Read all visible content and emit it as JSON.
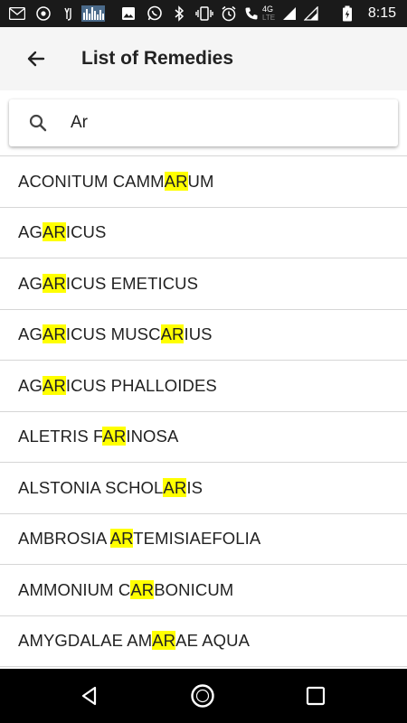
{
  "status_bar": {
    "time": "8:15",
    "network_label": "4G",
    "icons": [
      "gmail-icon",
      "chrome-icon",
      "yj-icon",
      "equalizer-icon",
      "image-icon",
      "whatsapp-icon",
      "bluetooth-icon",
      "vibrate-icon",
      "alarm-icon",
      "phone-call-icon",
      "lte-icon",
      "signal-icon",
      "signal-icon",
      "battery-charging-icon"
    ]
  },
  "app_bar": {
    "title": "List of Remedies",
    "back_icon": "arrow-left-icon",
    "background": "#f5f5f5"
  },
  "search": {
    "value": "Ar",
    "icon": "search-icon"
  },
  "highlight_color": "#ffff00",
  "remedies": [
    {
      "before": "ACONITUM CAMM",
      "match": "AR",
      "after": "UM",
      "match2": "",
      "after2": ""
    },
    {
      "before": "AG",
      "match": "AR",
      "after": "ICUS",
      "match2": "",
      "after2": ""
    },
    {
      "before": "AG",
      "match": "AR",
      "after": "ICUS EMETICUS",
      "match2": "",
      "after2": ""
    },
    {
      "before": "AG",
      "match": "AR",
      "after": "ICUS MUSC",
      "match2": "AR",
      "after2": "IUS"
    },
    {
      "before": "AG",
      "match": "AR",
      "after": "ICUS PHALLOIDES",
      "match2": "",
      "after2": ""
    },
    {
      "before": "ALETRIS F",
      "match": "AR",
      "after": "INOSA",
      "match2": "",
      "after2": ""
    },
    {
      "before": "ALSTONIA SCHOL",
      "match": "AR",
      "after": "IS",
      "match2": "",
      "after2": ""
    },
    {
      "before": "AMBROSIA ",
      "match": "AR",
      "after": "TEMISIAEFOLIA",
      "match2": "",
      "after2": ""
    },
    {
      "before": "AMMONIUM C",
      "match": "AR",
      "after": "BONICUM",
      "match2": "",
      "after2": ""
    },
    {
      "before": "AMYGDALAE AM",
      "match": "AR",
      "after": "AE AQUA",
      "match2": "",
      "after2": ""
    }
  ],
  "nav_bar": {
    "icons": [
      "back-triangle-icon",
      "home-circle-icon",
      "recents-square-icon"
    ]
  }
}
